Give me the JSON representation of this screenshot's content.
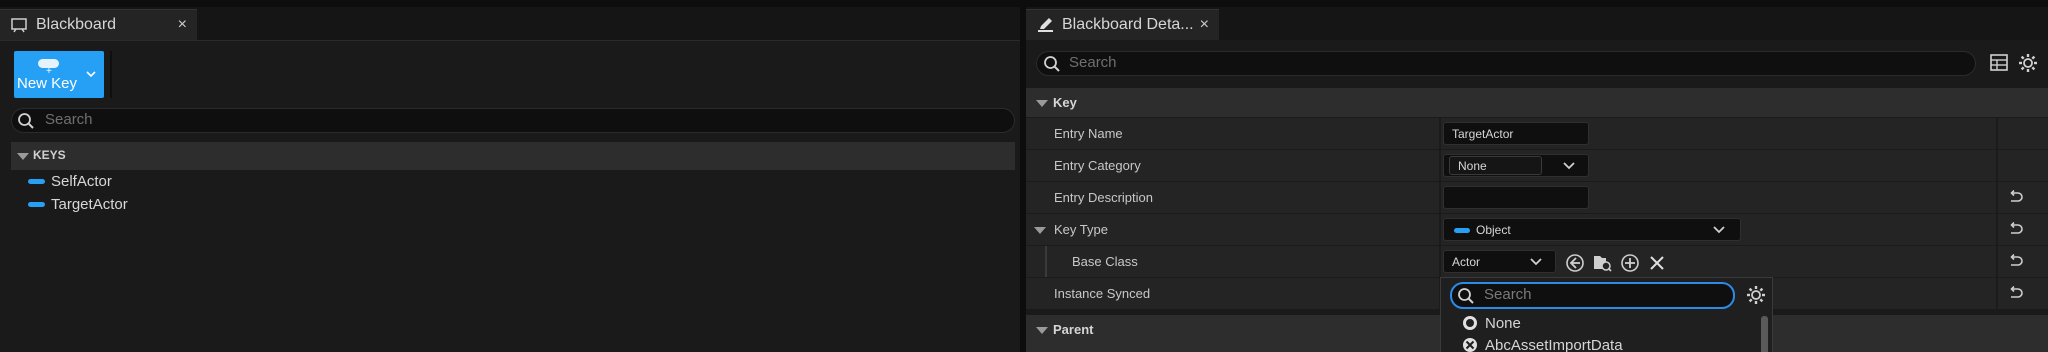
{
  "left_panel": {
    "tab_title": "Blackboard",
    "close": "×",
    "new_key_label": "New Key",
    "search_placeholder": "Search",
    "keys_header": "KEYS",
    "keys": [
      "SelfActor",
      "TargetActor"
    ]
  },
  "right_panel": {
    "tab_title": "Blackboard Deta...",
    "close": "×",
    "search_placeholder": "Search",
    "sections": {
      "key": "Key",
      "parent": "Parent"
    },
    "properties": {
      "entry_name": {
        "label": "Entry Name",
        "value": "TargetActor"
      },
      "entry_category": {
        "label": "Entry Category",
        "value": "None"
      },
      "entry_description": {
        "label": "Entry Description",
        "value": ""
      },
      "key_type": {
        "label": "Key Type",
        "value": "Object"
      },
      "base_class": {
        "label": "Base Class",
        "value": "Actor"
      },
      "instance_synced": {
        "label": "Instance Synced"
      }
    },
    "class_picker": {
      "search_placeholder": "Search",
      "items": [
        "None",
        "AbcAssetImportData"
      ]
    }
  },
  "colors": {
    "accent": "#26a0f5",
    "focus": "#2d8be8",
    "background": "#1a1a1a",
    "header": "#2d2d2d"
  }
}
